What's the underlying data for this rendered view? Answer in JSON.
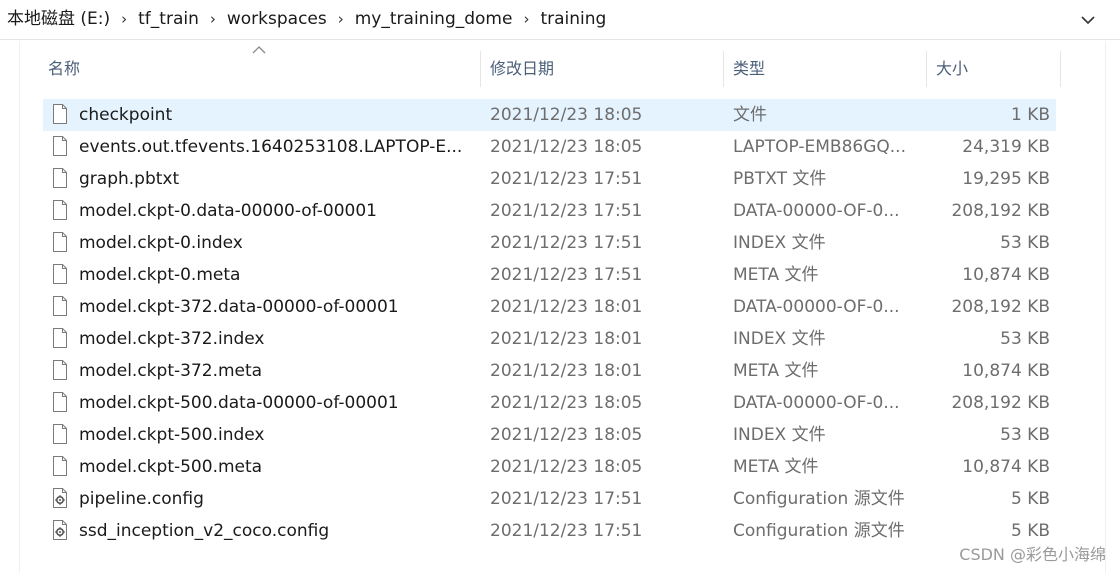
{
  "breadcrumb": [
    "本地磁盘 (E:)",
    "tf_train",
    "workspaces",
    "my_training_dome",
    "training"
  ],
  "columns": {
    "name": "名称",
    "date": "修改日期",
    "type": "类型",
    "size": "大小"
  },
  "files": [
    {
      "name": "checkpoint",
      "date": "2021/12/23 18:05",
      "type": "文件",
      "size": "1 KB",
      "icon": "file-icon"
    },
    {
      "name": "events.out.tfevents.1640253108.LAPTOP-E...",
      "date": "2021/12/23 18:05",
      "type": "LAPTOP-EMB86GQ...",
      "size": "24,319 KB",
      "icon": "file-icon"
    },
    {
      "name": "graph.pbtxt",
      "date": "2021/12/23 17:51",
      "type": "PBTXT 文件",
      "size": "19,295 KB",
      "icon": "file-icon"
    },
    {
      "name": "model.ckpt-0.data-00000-of-00001",
      "date": "2021/12/23 17:51",
      "type": "DATA-00000-OF-0...",
      "size": "208,192 KB",
      "icon": "file-icon"
    },
    {
      "name": "model.ckpt-0.index",
      "date": "2021/12/23 17:51",
      "type": "INDEX 文件",
      "size": "53 KB",
      "icon": "file-icon"
    },
    {
      "name": "model.ckpt-0.meta",
      "date": "2021/12/23 17:51",
      "type": "META 文件",
      "size": "10,874 KB",
      "icon": "file-icon"
    },
    {
      "name": "model.ckpt-372.data-00000-of-00001",
      "date": "2021/12/23 18:01",
      "type": "DATA-00000-OF-0...",
      "size": "208,192 KB",
      "icon": "file-icon"
    },
    {
      "name": "model.ckpt-372.index",
      "date": "2021/12/23 18:01",
      "type": "INDEX 文件",
      "size": "53 KB",
      "icon": "file-icon"
    },
    {
      "name": "model.ckpt-372.meta",
      "date": "2021/12/23 18:01",
      "type": "META 文件",
      "size": "10,874 KB",
      "icon": "file-icon"
    },
    {
      "name": "model.ckpt-500.data-00000-of-00001",
      "date": "2021/12/23 18:05",
      "type": "DATA-00000-OF-0...",
      "size": "208,192 KB",
      "icon": "file-icon"
    },
    {
      "name": "model.ckpt-500.index",
      "date": "2021/12/23 18:05",
      "type": "INDEX 文件",
      "size": "53 KB",
      "icon": "file-icon"
    },
    {
      "name": "model.ckpt-500.meta",
      "date": "2021/12/23 18:05",
      "type": "META 文件",
      "size": "10,874 KB",
      "icon": "file-icon"
    },
    {
      "name": "pipeline.config",
      "date": "2021/12/23 17:51",
      "type": "Configuration 源文件",
      "size": "5 KB",
      "icon": "config-file-icon"
    },
    {
      "name": "ssd_inception_v2_coco.config",
      "date": "2021/12/23 17:51",
      "type": "Configuration 源文件",
      "size": "5 KB",
      "icon": "config-file-icon"
    }
  ],
  "selected_index": 0,
  "watermark": "CSDN @彩色小海绵",
  "colors": {
    "selected_row": "#e5f3ff",
    "header_text": "#4c607a",
    "secondary_text": "#6d6d6d"
  }
}
